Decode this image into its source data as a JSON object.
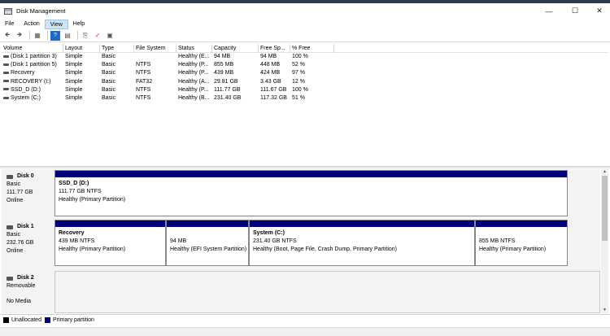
{
  "window": {
    "title": "Disk Management"
  },
  "menu": [
    "File",
    "Action",
    "View",
    "Help"
  ],
  "table": {
    "columns": [
      "Volume",
      "Layout",
      "Type",
      "File System",
      "Status",
      "Capacity",
      "Free Sp...",
      "% Free"
    ],
    "rows": [
      [
        "(Disk 1 partition 3)",
        "Simple",
        "Basic",
        "",
        "Healthy (E...",
        "94 MB",
        "94 MB",
        "100 %"
      ],
      [
        "(Disk 1 partition 5)",
        "Simple",
        "Basic",
        "NTFS",
        "Healthy (P...",
        "855 MB",
        "448 MB",
        "52 %"
      ],
      [
        "Recovery",
        "Simple",
        "Basic",
        "NTFS",
        "Healthy (P...",
        "439 MB",
        "424 MB",
        "97 %"
      ],
      [
        "RECOVERY (I:)",
        "Simple",
        "Basic",
        "FAT32",
        "Healthy (A...",
        "29.81 GB",
        "3.43 GB",
        "12 %"
      ],
      [
        "SSD_D (D:)",
        "Simple",
        "Basic",
        "NTFS",
        "Healthy (P...",
        "111.77 GB",
        "111.67 GB",
        "100 %"
      ],
      [
        "System (C:)",
        "Simple",
        "Basic",
        "NTFS",
        "Healthy (B...",
        "231.40 GB",
        "117.32 GB",
        "51 %"
      ]
    ]
  },
  "disks": [
    {
      "name": "Disk 0",
      "type": "Basic",
      "size": "111.77 GB",
      "status": "Online",
      "partitions": [
        {
          "name": "SSD_D  (D:)",
          "size": "111.77 GB NTFS",
          "status": "Healthy (Primary Partition)"
        }
      ]
    },
    {
      "name": "Disk 1",
      "type": "Basic",
      "size": "232.76 GB",
      "status": "Online",
      "partitions": [
        {
          "name": "Recovery",
          "size": "439 MB NTFS",
          "status": "Healthy (Primary Partition)"
        },
        {
          "name": "",
          "size": "94 MB",
          "status": "Healthy (EFI System Partition)"
        },
        {
          "name": "System  (C:)",
          "size": "231.40 GB NTFS",
          "status": "Healthy (Boot, Page File, Crash Dump, Primary Partition)"
        },
        {
          "name": "",
          "size": "855 MB NTFS",
          "status": "Healthy (Primary Partition)"
        }
      ]
    },
    {
      "name": "Disk 2",
      "type": "Removable",
      "size": "",
      "status": "No Media",
      "partitions": []
    }
  ],
  "legend": [
    {
      "label": "Unallocated",
      "color": "#000000"
    },
    {
      "label": "Primary partition",
      "color": "#00007b"
    }
  ]
}
